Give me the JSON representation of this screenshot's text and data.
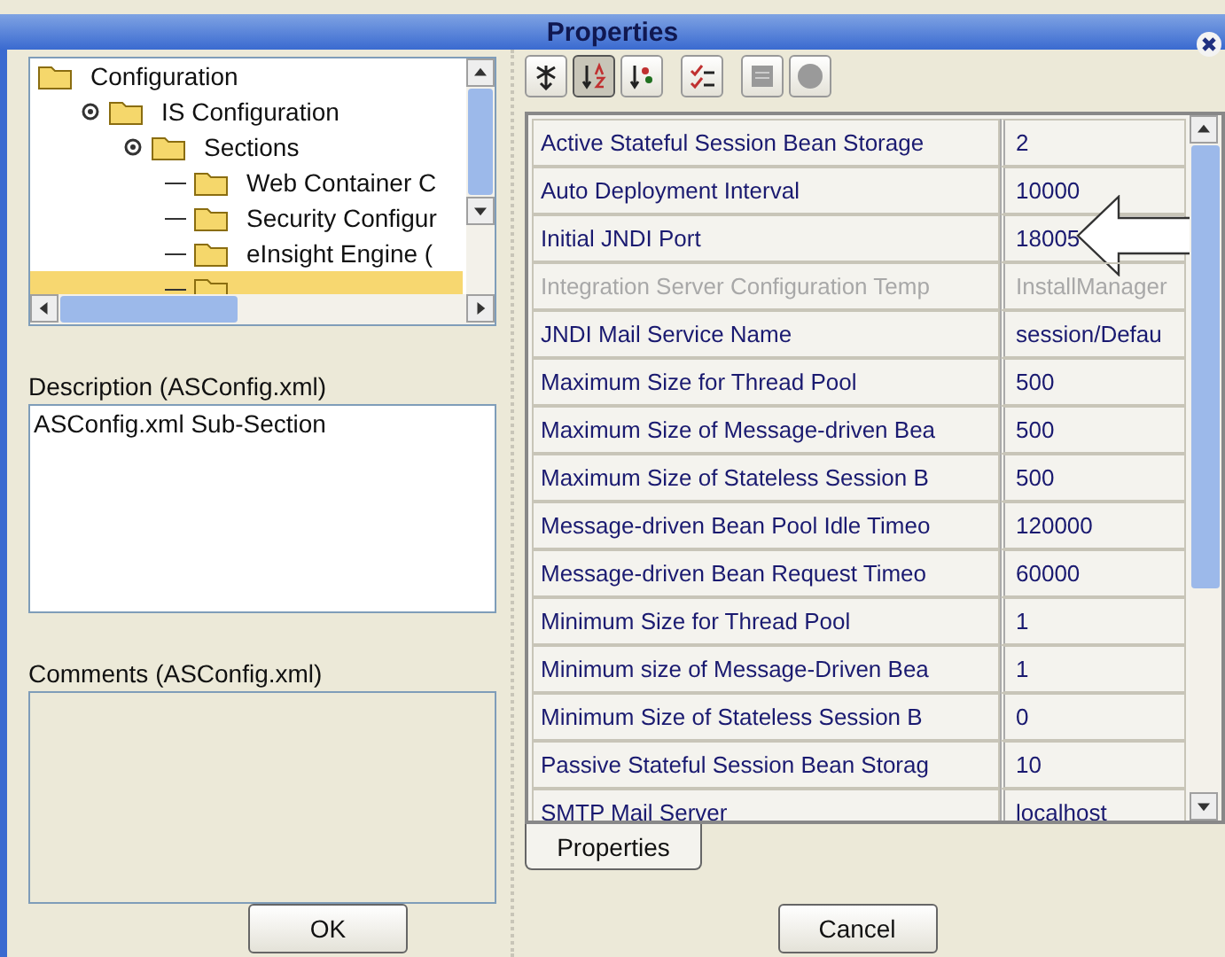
{
  "window": {
    "title": "Properties"
  },
  "tree": {
    "items": [
      {
        "label": "Configuration",
        "selected": false,
        "children": [
          {
            "label": "IS Configuration",
            "selected": false,
            "expanded": true,
            "children": [
              {
                "label": "Sections",
                "selected": false,
                "expanded": true,
                "children": [
                  {
                    "label": "Web Container C",
                    "selected": false
                  },
                  {
                    "label": "Security Configur",
                    "selected": false
                  },
                  {
                    "label": "eInsight Engine (",
                    "selected": false
                  },
                  {
                    "selected": true
                  }
                ]
              }
            ]
          }
        ]
      }
    ]
  },
  "description": {
    "label": "Description (ASConfig.xml)",
    "value": "ASConfig.xml Sub-Section"
  },
  "comments": {
    "label": "Comments (ASConfig.xml)"
  },
  "toolbar": [
    {
      "kind": "collapse",
      "selected": false
    },
    {
      "kind": "sort-az",
      "selected": true
    },
    {
      "kind": "sort-category",
      "selected": false
    },
    {
      "kind": "checklist",
      "selected": false
    },
    {
      "kind": "panel",
      "selected": false
    },
    {
      "kind": "help",
      "selected": false
    }
  ],
  "table": {
    "rows": [
      {
        "name": "Active Stateful Session Bean Storage",
        "value": "2",
        "disabled": false
      },
      {
        "name": "Auto Deployment Interval",
        "value": "10000",
        "disabled": false
      },
      {
        "name": "Initial JNDI Port",
        "value": "18005",
        "disabled": false,
        "callout": true
      },
      {
        "name": "Integration Server Configuration Temp",
        "value": "InstallManager",
        "disabled": true
      },
      {
        "name": "JNDI Mail Service Name",
        "value": "session/Defau",
        "disabled": false
      },
      {
        "name": "Maximum Size for Thread Pool",
        "value": "500",
        "disabled": false
      },
      {
        "name": "Maximum Size of Message-driven Bea",
        "value": "500",
        "disabled": false
      },
      {
        "name": "Maximum Size of Stateless Session B",
        "value": "500",
        "disabled": false
      },
      {
        "name": "Message-driven Bean Pool Idle Timeo",
        "value": "120000",
        "disabled": false
      },
      {
        "name": "Message-driven Bean Request Timeo",
        "value": "60000",
        "disabled": false
      },
      {
        "name": "Minimum Size for Thread Pool",
        "value": "1",
        "disabled": false
      },
      {
        "name": "Minimum size of Message-Driven Bea",
        "value": "1",
        "disabled": false
      },
      {
        "name": "Minimum Size of Stateless Session B",
        "value": "0",
        "disabled": false
      },
      {
        "name": "Passive Stateful Session Bean Storag",
        "value": "10",
        "disabled": false
      },
      {
        "name": "SMTP Mail Server",
        "value": "localhost",
        "disabled": false
      }
    ]
  },
  "tabs": [
    {
      "label": "Properties",
      "selected": true
    }
  ],
  "buttons": [
    "OK",
    "Cancel"
  ]
}
